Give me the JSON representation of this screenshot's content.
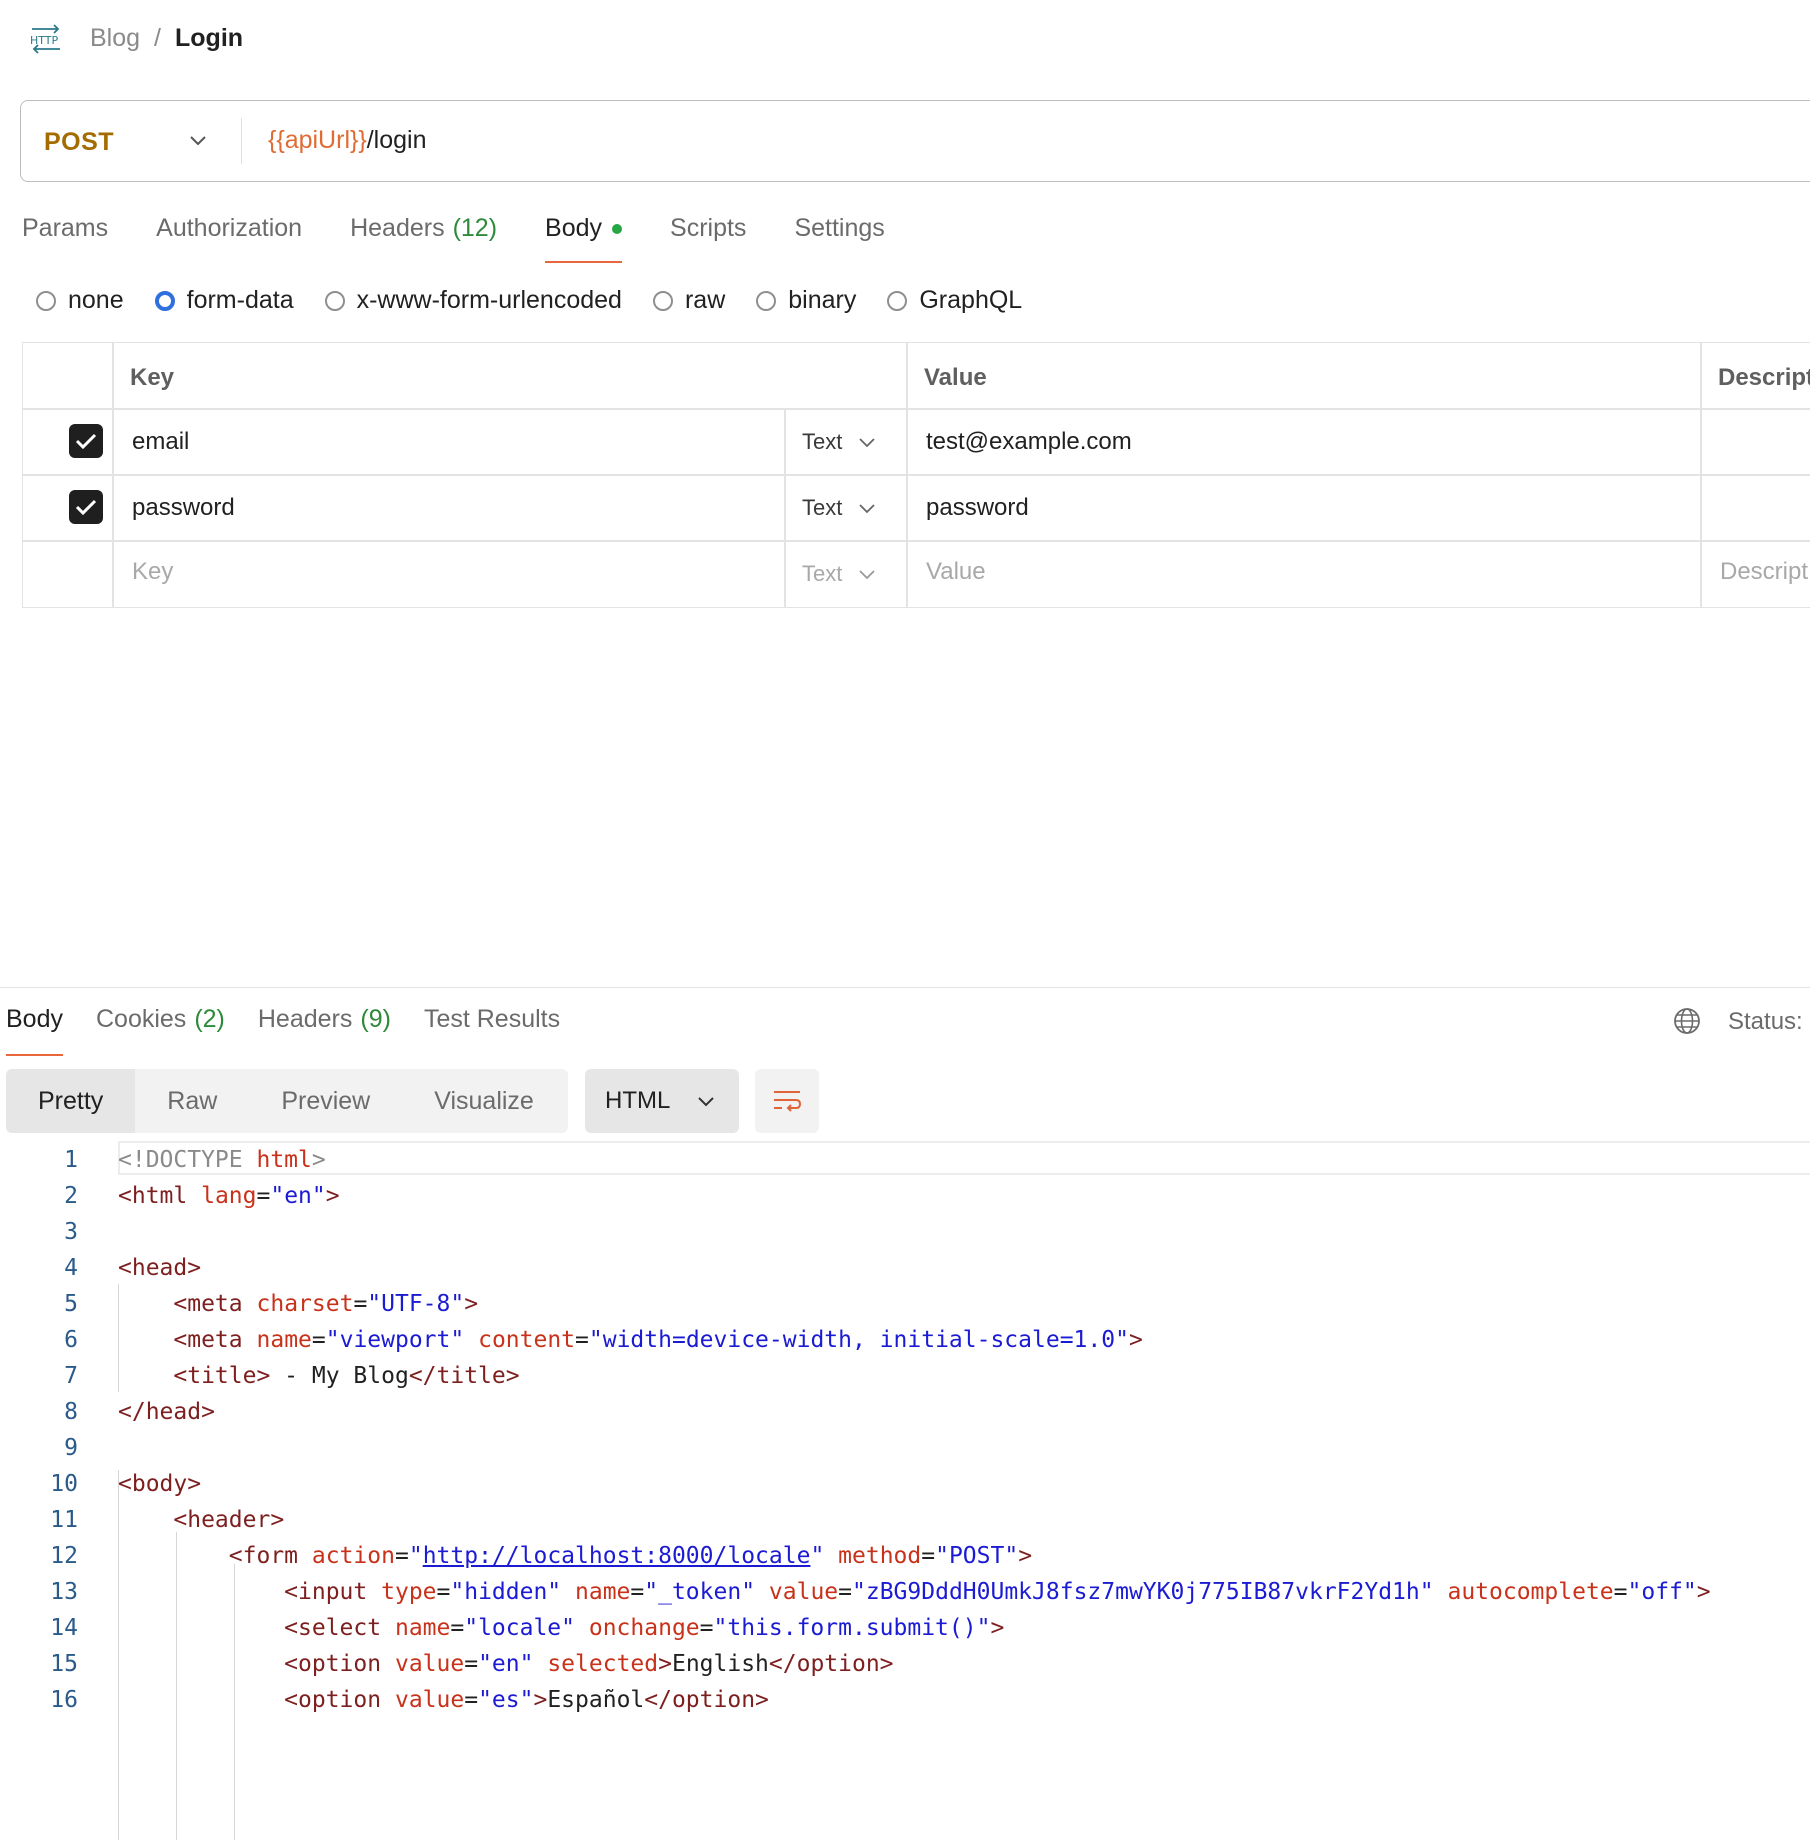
{
  "breadcrumb": {
    "icon": "http-icon",
    "icon_text": "HTTP",
    "collection": "Blog",
    "separator": "/",
    "request": "Login"
  },
  "request": {
    "method": "POST",
    "url_var": "{{apiUrl}}",
    "url_path": "/login"
  },
  "tabs": [
    {
      "label": "Params"
    },
    {
      "label": "Authorization"
    },
    {
      "label": "Headers",
      "count": "(12)"
    },
    {
      "label": "Body",
      "active": true
    },
    {
      "label": "Scripts"
    },
    {
      "label": "Settings"
    }
  ],
  "body_types": [
    {
      "label": "none"
    },
    {
      "label": "form-data",
      "selected": true
    },
    {
      "label": "x-www-form-urlencoded"
    },
    {
      "label": "raw"
    },
    {
      "label": "binary"
    },
    {
      "label": "GraphQL"
    }
  ],
  "form_table": {
    "headers": {
      "key": "Key",
      "value": "Value",
      "description": "Descript"
    },
    "rows": [
      {
        "checked": true,
        "key": "email",
        "type": "Text",
        "value": "test@example.com"
      },
      {
        "checked": true,
        "key": "password",
        "type": "Text",
        "value": "password"
      }
    ],
    "new_row": {
      "key_placeholder": "Key",
      "type": "Text",
      "value_placeholder": "Value",
      "description_placeholder": "Descript"
    }
  },
  "response": {
    "tabs": [
      {
        "label": "Body",
        "active": true
      },
      {
        "label": "Cookies",
        "count": "(2)"
      },
      {
        "label": "Headers",
        "count": "(9)"
      },
      {
        "label": "Test Results"
      }
    ],
    "status_label": "Status:",
    "view_modes": [
      "Pretty",
      "Raw",
      "Preview",
      "Visualize"
    ],
    "active_view": "Pretty",
    "format": "HTML",
    "line_numbers": [
      "1",
      "2",
      "3",
      "4",
      "5",
      "6",
      "7",
      "8",
      "9",
      "10",
      "11",
      "12",
      "13",
      "14",
      "15",
      "16"
    ]
  },
  "colors": {
    "accent": "#e8673c",
    "method": "#a46b00",
    "tag": "#7d1f1f",
    "attr": "#c8321b",
    "string": "#1b1bd3",
    "count": "#2e8a3a"
  }
}
